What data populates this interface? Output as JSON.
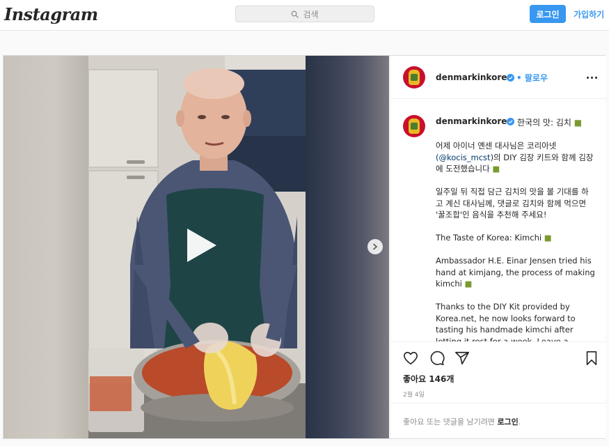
{
  "nav": {
    "logo": "Instagram",
    "search_placeholder": "검색",
    "login_label": "로그인",
    "signup_label": "가입하기"
  },
  "post": {
    "username": "denmarkinkorea",
    "follow_label": "팔로우",
    "caption_title": "한국의 맛: 김치",
    "caption": {
      "p1_before": "어제 아이너 옌센 대사님은 코리아넷",
      "p1_mention": "(@kocis_mcst",
      "p1_after": ")의 DIY 김장 키트와 함께 김장에 도전했습니다",
      "p2": "일주일 뒤 직접 담근 김치의 맛을 볼 기대를 하고 계신 대사님께, 댓글로 김치와 함께 먹으면 '꿀조합'인 음식을 추천해 주세요!",
      "p3": "The Taste of Korea: Kimchi",
      "p4": "Ambassador H.E. Einar Jensen tried his hand at kimjang, the process of making kimchi",
      "p5": "Thanks to the DIY Kit provided by Korea.net, he now looks forward to tasting his handmade kimchi after letting it rest for a week. Leave a comment below with"
    },
    "likes": "좋아요 146개",
    "date": "2월 4일",
    "comment_prompt": "좋아요 또는 댓글을 남기려면",
    "comment_login": "로그인",
    "comment_suffix": "."
  },
  "colors": {
    "accent": "#3897f0",
    "avatar_bg": "#c8102e"
  },
  "icons": [
    "search-icon",
    "play-icon",
    "chevron-right-icon",
    "verified-icon",
    "more-icon",
    "heart-icon",
    "comment-icon",
    "share-icon",
    "bookmark-icon"
  ]
}
